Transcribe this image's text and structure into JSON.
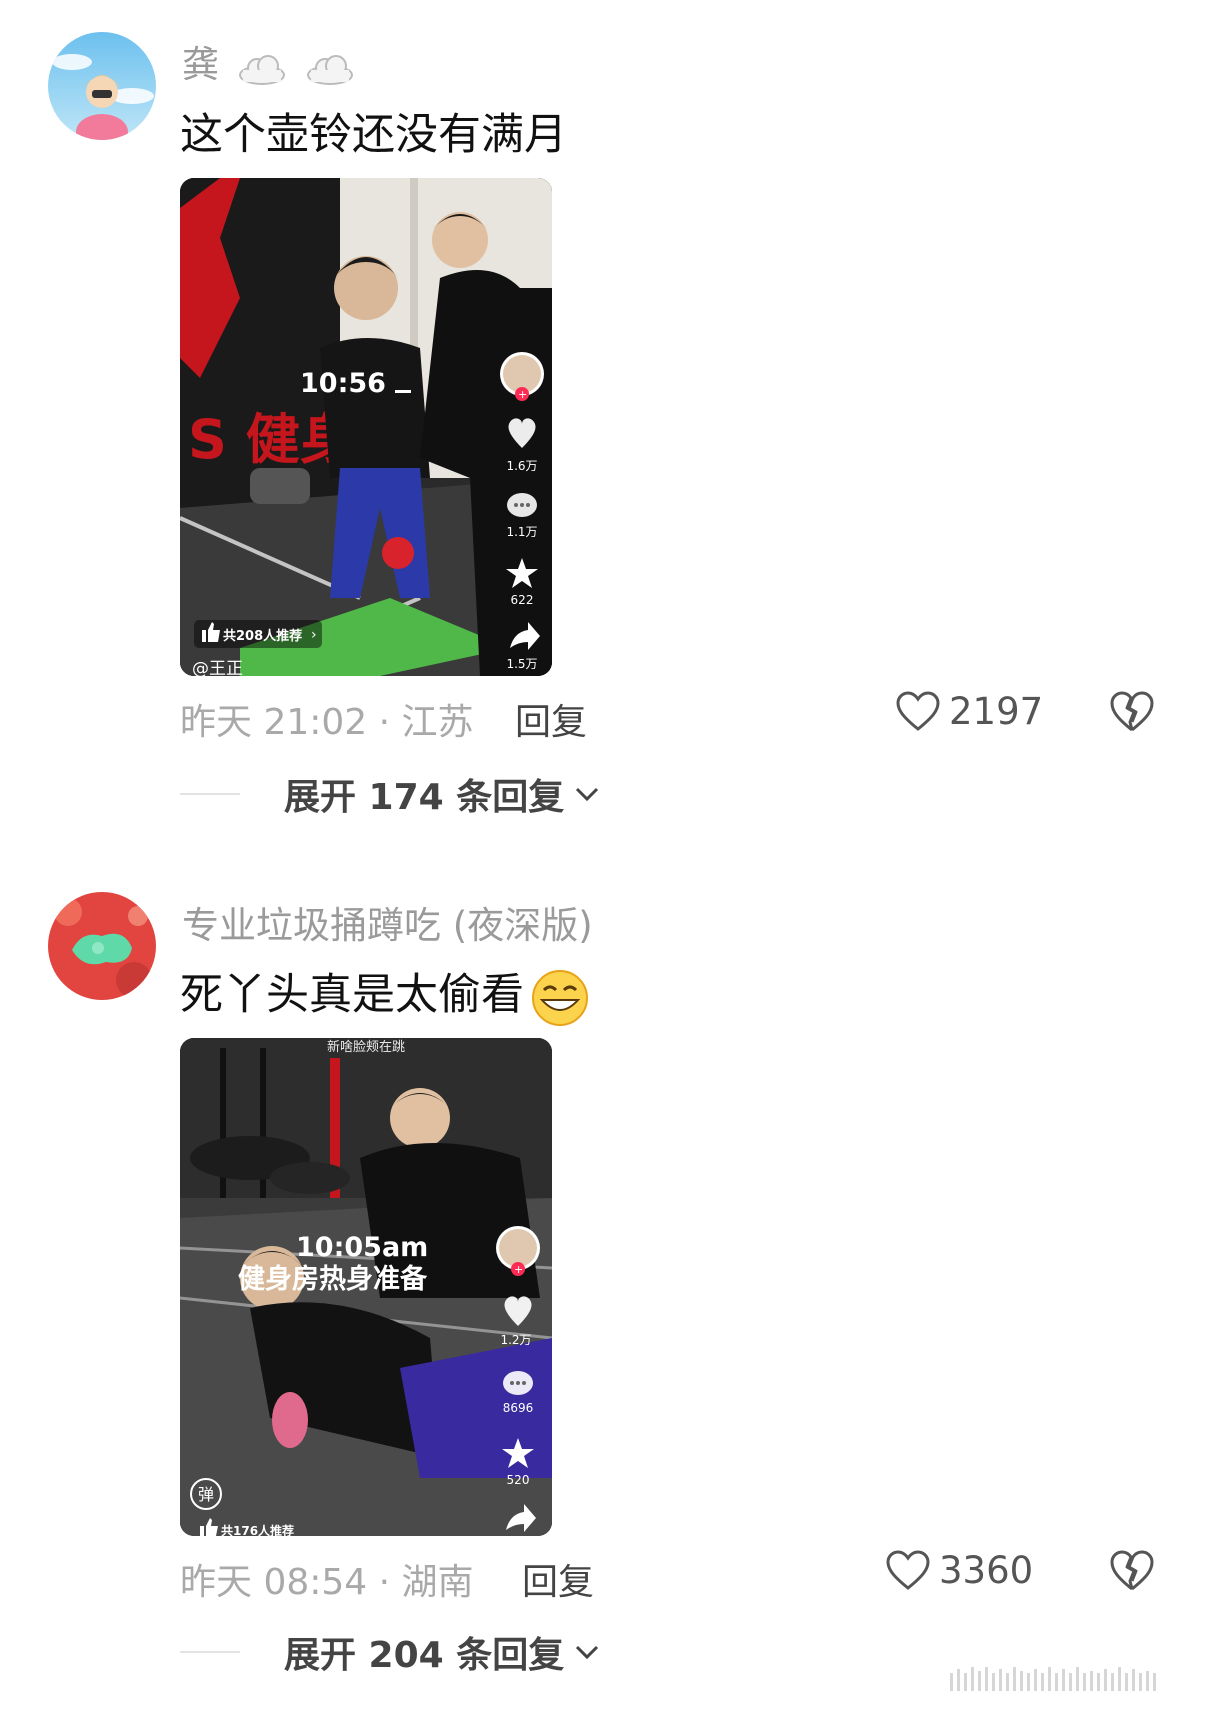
{
  "comments": [
    {
      "username": "龚",
      "content": "这个壶铃还没有满月",
      "video": {
        "time_text": "10:56",
        "likes": "1.6万",
        "comments": "1.1万",
        "stars": "622",
        "shares": "1.5万",
        "recommend": "共208人推荐",
        "brand_text": "S 健身",
        "author_partial": "@王正"
      },
      "timestamp": "昨天 21:02 · 江苏",
      "reply_label": "回复",
      "like_count": "2197",
      "expand_label": "展开 174 条回复"
    },
    {
      "username": "专业垃圾捅蹲吃 (夜深版)",
      "content": "死丫头真是太偷看",
      "video": {
        "top_caption": "新啥脸颊在跳",
        "time_text": "10:05am",
        "subtitle": "健身房热身准备",
        "likes": "1.2万",
        "comments": "8696",
        "stars": "520",
        "danmu": "弹",
        "recommend": "共176人推荐"
      },
      "timestamp": "昨天 08:54 · 湖南",
      "reply_label": "回复",
      "like_count": "3360",
      "expand_label": "展开 204 条回复"
    }
  ],
  "colors": {
    "muted": "#a9a9a9",
    "text": "#111111",
    "accent_red": "#fe2c55"
  }
}
